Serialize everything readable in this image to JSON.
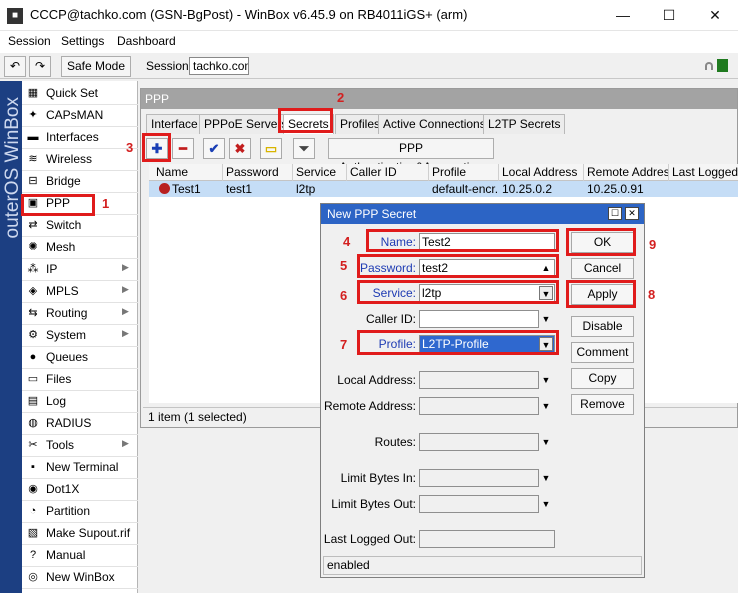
{
  "window": {
    "title": "CCCP@tachko.com (GSN-BgPost) - WinBox v6.45.9 on RB4011iGS+ (arm)"
  },
  "menu": [
    "Session",
    "Settings",
    "Dashboard"
  ],
  "toolbar": {
    "safe_mode": "Safe Mode",
    "session_label": "Session:",
    "session_value": "tachko.com"
  },
  "side_label": "outerOS WinBox",
  "sidebar": {
    "items": [
      {
        "label": "Quick Set",
        "icon": "quickset-icon",
        "glyph": "▦"
      },
      {
        "label": "CAPsMAN",
        "icon": "capsman-icon",
        "glyph": "✦"
      },
      {
        "label": "Interfaces",
        "icon": "interfaces-icon",
        "glyph": "▬"
      },
      {
        "label": "Wireless",
        "icon": "wireless-icon",
        "glyph": "≋"
      },
      {
        "label": "Bridge",
        "icon": "bridge-icon",
        "glyph": "⊟"
      },
      {
        "label": "PPP",
        "icon": "ppp-icon",
        "glyph": "▣"
      },
      {
        "label": "Switch",
        "icon": "switch-icon",
        "glyph": "⇄"
      },
      {
        "label": "Mesh",
        "icon": "mesh-icon",
        "glyph": "✺"
      },
      {
        "label": "IP",
        "icon": "ip-icon",
        "glyph": "⁂",
        "arrow": "▶"
      },
      {
        "label": "MPLS",
        "icon": "mpls-icon",
        "glyph": "◈",
        "arrow": "▶"
      },
      {
        "label": "Routing",
        "icon": "routing-icon",
        "glyph": "⇆",
        "arrow": "▶"
      },
      {
        "label": "System",
        "icon": "system-icon",
        "glyph": "⚙",
        "arrow": "▶"
      },
      {
        "label": "Queues",
        "icon": "queues-icon",
        "glyph": "●"
      },
      {
        "label": "Files",
        "icon": "files-icon",
        "glyph": "▭"
      },
      {
        "label": "Log",
        "icon": "log-icon",
        "glyph": "▤"
      },
      {
        "label": "RADIUS",
        "icon": "radius-icon",
        "glyph": "◍"
      },
      {
        "label": "Tools",
        "icon": "tools-icon",
        "glyph": "✂",
        "arrow": "▶"
      },
      {
        "label": "New Terminal",
        "icon": "terminal-icon",
        "glyph": "▪"
      },
      {
        "label": "Dot1X",
        "icon": "dot1x-icon",
        "glyph": "◉"
      },
      {
        "label": "Partition",
        "icon": "partition-icon",
        "glyph": "◔"
      },
      {
        "label": "Make Supout.rif",
        "icon": "supout-icon",
        "glyph": "▧"
      },
      {
        "label": "Manual",
        "icon": "manual-icon",
        "glyph": "?"
      },
      {
        "label": "New WinBox",
        "icon": "winbox-icon",
        "glyph": "◎"
      }
    ]
  },
  "ppp": {
    "title": "PPP",
    "tabs": [
      "Interface",
      "PPPoE Servers",
      "Secrets",
      "Profiles",
      "Active Connections",
      "L2TP Secrets"
    ],
    "auth_button": "PPP Authentication&Accounting",
    "columns": [
      "Name",
      "Password",
      "Service",
      "Caller ID",
      "Profile",
      "Local Address",
      "Remote Address",
      "Last Logged Out"
    ],
    "row": [
      "Test1",
      "test1",
      "l2tp",
      "",
      "default-encr...",
      "10.25.0.2",
      "10.25.0.91",
      ""
    ],
    "status": "1 item (1 selected)"
  },
  "dialog": {
    "title": "New PPP Secret",
    "fields": [
      {
        "label": "Name:",
        "value": "Test2"
      },
      {
        "label": "Password:",
        "value": "test2"
      },
      {
        "label": "Service:",
        "value": "l2tp"
      },
      {
        "label": "Caller ID:",
        "value": ""
      },
      {
        "label": "Profile:",
        "value": "L2TP-Profile"
      },
      {
        "label": "Local Address:",
        "value": ""
      },
      {
        "label": "Remote Address:",
        "value": ""
      },
      {
        "label": "Routes:",
        "value": ""
      },
      {
        "label": "Limit Bytes In:",
        "value": ""
      },
      {
        "label": "Limit Bytes Out:",
        "value": ""
      },
      {
        "label": "Last Logged Out:",
        "value": ""
      }
    ],
    "buttons": [
      "OK",
      "Cancel",
      "Apply",
      "Disable",
      "Comment",
      "Copy",
      "Remove"
    ],
    "status": "enabled"
  },
  "annotations": [
    "1",
    "2",
    "3",
    "4",
    "5",
    "6",
    "7",
    "8",
    "9"
  ],
  "colors": {
    "annotation": "#e01b1b",
    "dialog_title": "#2c64c5",
    "selection": "#c5ddf6",
    "side_label": "#1c3f82"
  }
}
